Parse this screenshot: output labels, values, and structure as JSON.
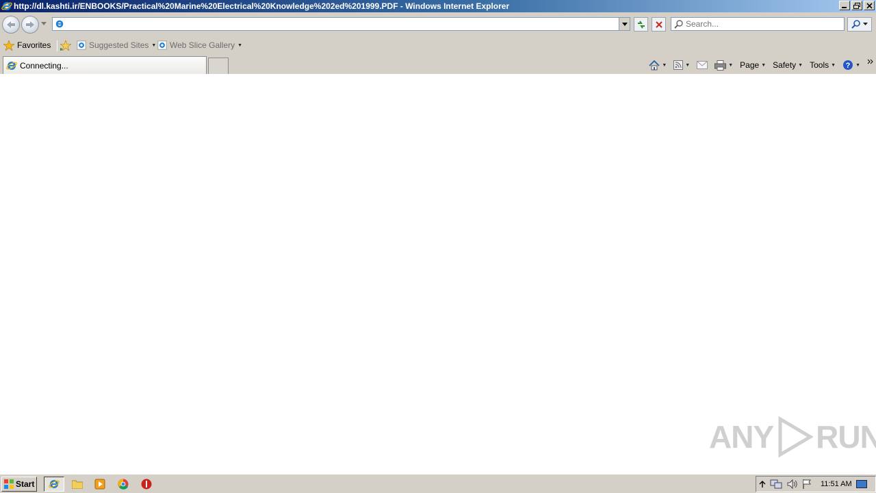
{
  "window": {
    "title": "http://dl.kashti.ir/ENBOOKS/Practical%20Marine%20Electrical%20Knowledge%202ed%201999.PDF - Windows Internet Explorer"
  },
  "address_bar": {
    "value": "",
    "placeholder": ""
  },
  "search": {
    "placeholder": "Search..."
  },
  "favorites_bar": {
    "favorites_label": "Favorites",
    "items": [
      {
        "label": "Suggested Sites",
        "icon": "ie-page-icon"
      },
      {
        "label": "Web Slice Gallery",
        "icon": "ie-page-icon"
      }
    ]
  },
  "tab": {
    "label": "Connecting..."
  },
  "command_bar": {
    "page_label": "Page",
    "safety_label": "Safety",
    "tools_label": "Tools"
  },
  "watermark": {
    "text_left": "ANY",
    "text_right": "RUN"
  },
  "taskbar": {
    "start_label": "Start",
    "apps": [
      "internet-explorer",
      "file-explorer",
      "media-player",
      "chrome",
      "stop-app"
    ],
    "clock": "11:51 AM"
  },
  "colors": {
    "title_gradient_start": "#0a246a",
    "chrome_bg": "#d4d0c8",
    "content_bg": "#ffffff"
  }
}
